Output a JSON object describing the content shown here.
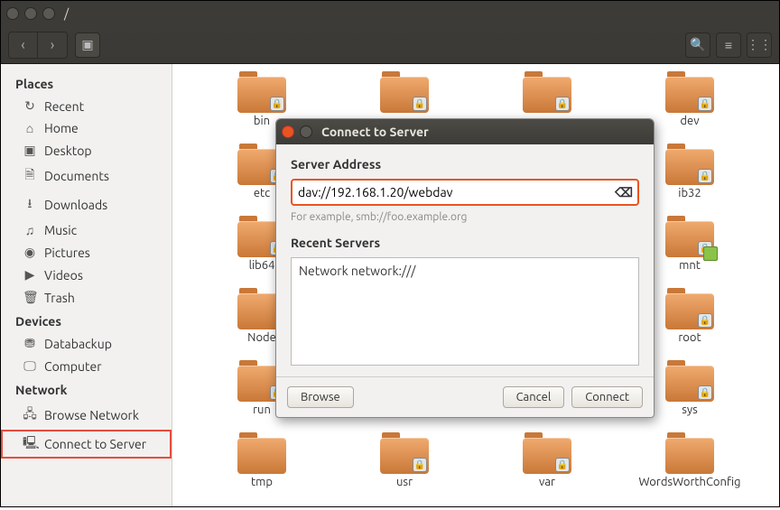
{
  "window": {
    "title": "/"
  },
  "sidebar": {
    "places_head": "Places",
    "devices_head": "Devices",
    "network_head": "Network",
    "places": [
      {
        "icon": "↻",
        "label": "Recent"
      },
      {
        "icon": "⌂",
        "label": "Home"
      },
      {
        "icon": "▣",
        "label": "Desktop"
      },
      {
        "icon": "🗎",
        "label": "Documents"
      },
      {
        "icon": "⭳",
        "label": "Downloads"
      },
      {
        "icon": "♫",
        "label": "Music"
      },
      {
        "icon": "◉",
        "label": "Pictures"
      },
      {
        "icon": "▶",
        "label": "Videos"
      },
      {
        "icon": "🗑",
        "label": "Trash"
      }
    ],
    "devices": [
      {
        "icon": "⛃",
        "label": "Databackup"
      },
      {
        "icon": "🖵",
        "label": "Computer"
      }
    ],
    "network": [
      {
        "icon": "🖧",
        "label": "Browse Network"
      },
      {
        "icon": "🖳",
        "label": "Connect to Server"
      }
    ]
  },
  "folders": {
    "row1": [
      "bin",
      "",
      "",
      "dev"
    ],
    "row2": [
      "etc",
      "",
      "",
      "ib32"
    ],
    "row3": [
      "lib64",
      "",
      "",
      "mnt"
    ],
    "row4": [
      "Node",
      "",
      "",
      "root"
    ],
    "row5": [
      "run",
      "",
      "",
      "sys"
    ],
    "row6": [
      "tmp",
      "usr",
      "var",
      "WordsWorthConfig"
    ]
  },
  "dialog": {
    "title": "Connect to Server",
    "address_label": "Server Address",
    "address_value": "dav://192.168.1.20/webdav",
    "hint": "For example, smb://foo.example.org",
    "recent_label": "Recent Servers",
    "recent_item": "Network  network:///",
    "browse": "Browse",
    "cancel": "Cancel",
    "connect": "Connect"
  }
}
